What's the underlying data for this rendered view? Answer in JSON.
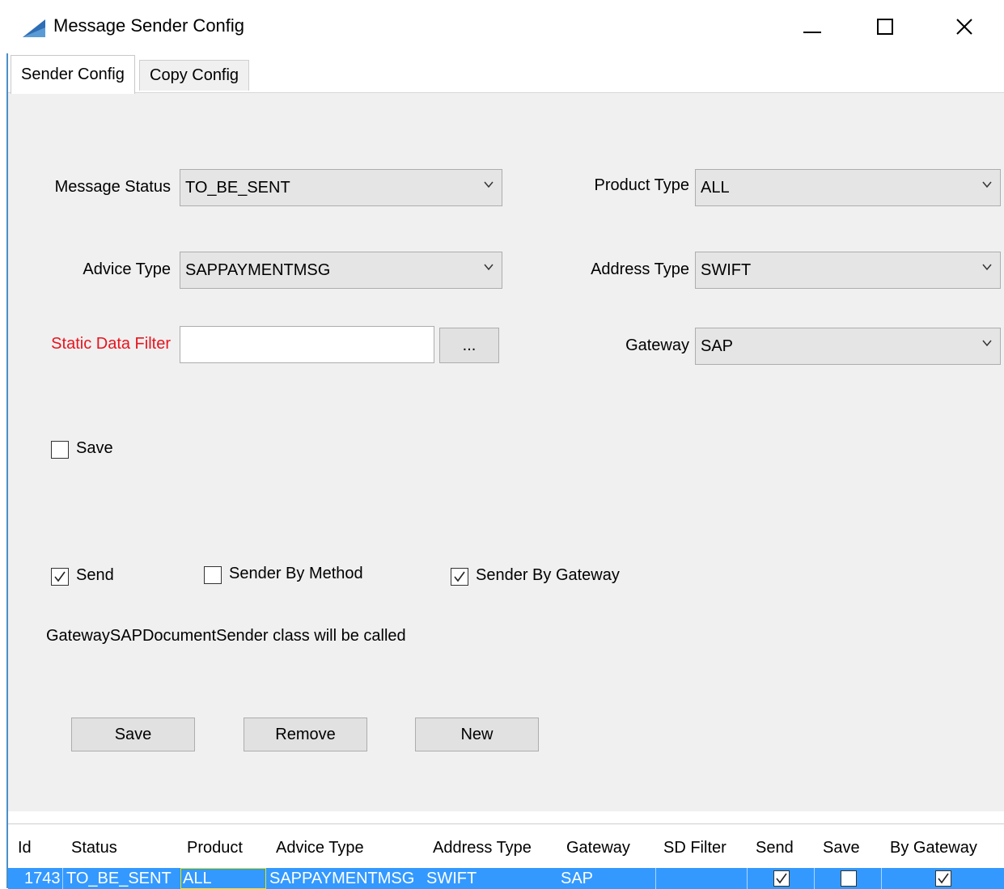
{
  "window": {
    "title": "Message Sender Config",
    "controls": {
      "minimize": "minimize",
      "maximize": "maximize",
      "close": "close"
    }
  },
  "tabs": [
    {
      "label": "Sender Config",
      "active": true
    },
    {
      "label": "Copy Config",
      "active": false
    }
  ],
  "form": {
    "message_status": {
      "label": "Message Status",
      "value": "TO_BE_SENT"
    },
    "product_type": {
      "label": "Product Type",
      "value": "ALL"
    },
    "advice_type": {
      "label": "Advice Type",
      "value": "SAPPAYMENTMSG"
    },
    "address_type": {
      "label": "Address Type",
      "value": "SWIFT"
    },
    "static_data_filter": {
      "label": "Static Data Filter",
      "value": "",
      "button": "..."
    },
    "gateway": {
      "label": "Gateway",
      "value": "SAP"
    }
  },
  "checkboxes": {
    "save": {
      "label": "Save",
      "checked": false
    },
    "send": {
      "label": "Send",
      "checked": true
    },
    "sender_by_method": {
      "label": "Sender By Method",
      "checked": false
    },
    "sender_by_gateway": {
      "label": "Sender By Gateway",
      "checked": true
    }
  },
  "info": "GatewaySAPDocumentSender class will be called",
  "buttons": {
    "save": "Save",
    "remove": "Remove",
    "new": "New"
  },
  "table": {
    "columns": [
      "Id",
      "Status",
      "Product",
      "Advice Type",
      "Address Type",
      "Gateway",
      "SD Filter",
      "Send",
      "Save",
      "By Gateway"
    ],
    "rows": [
      {
        "id": "1743",
        "status": "TO_BE_SENT",
        "product": "ALL",
        "advice_type": "SAPPAYMENTMSG",
        "address_type": "SWIFT",
        "gateway": "SAP",
        "sd_filter": "",
        "send": true,
        "save": false,
        "by_gateway": true,
        "selected": true
      }
    ]
  },
  "colors": {
    "accent": "#3399ff",
    "error_label": "#e8141e",
    "panel": "#f0f0f0",
    "window_border": "#4a90c8"
  }
}
